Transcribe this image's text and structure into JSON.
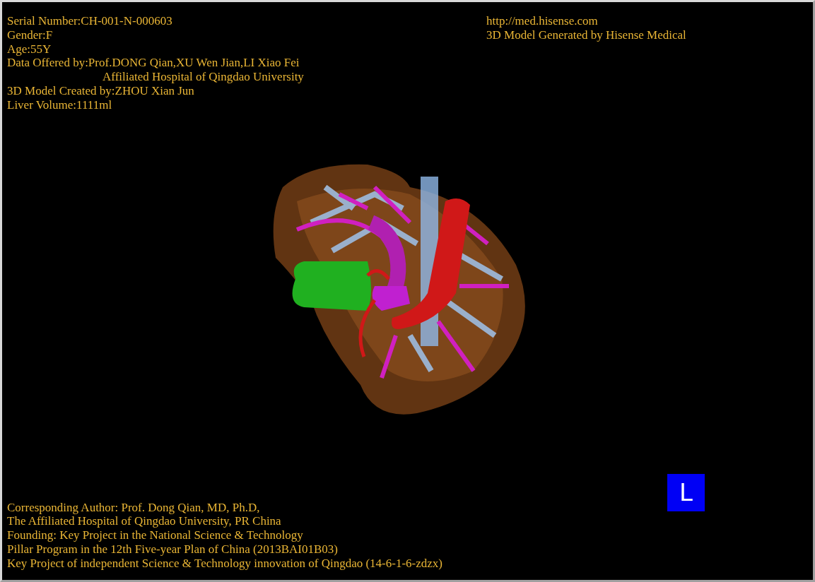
{
  "patient_info": [
    {
      "text": "Serial Number:CH-001-N-000603",
      "kind": "line"
    },
    {
      "text": "Gender:F",
      "kind": "line"
    },
    {
      "text": "Age:55Y",
      "kind": "line"
    },
    {
      "text": "Data Offered by:Prof.DONG Qian,XU Wen Jian,LI Xiao Fei",
      "kind": "line"
    },
    {
      "text": "Affiliated Hospital of Qingdao University",
      "kind": "indented"
    },
    {
      "text": "3D Model Created by:ZHOU Xian Jun",
      "kind": "line"
    },
    {
      "text": "Liver Volume:1111ml",
      "kind": "line"
    }
  ],
  "site_info": [
    "http://med.hisense.com",
    "3D Model Generated by Hisense Medical"
  ],
  "model_view": {
    "kind": "organ"
  },
  "orientation_marker": "L",
  "credits": [
    "Corresponding Author: Prof. Dong Qian, MD, Ph.D,",
    "The Affiliated Hospital of Qingdao University, PR China",
    "Founding: Key Project in the National Science & Technology",
    "Pillar Program in the 12th Five-year Plan of China (2013BAI01B03)",
    "Key Project of independent Science & Technology innovation of Qingdao (14-6-1-6-zdzx)"
  ]
}
